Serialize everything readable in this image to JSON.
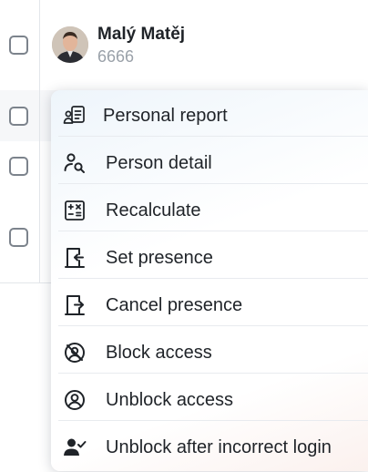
{
  "list": {
    "selected_person": {
      "name": "Malý Matěj",
      "id": "6666"
    }
  },
  "context_menu": {
    "items": [
      {
        "label": "Personal report",
        "icon": "personal-report-icon"
      },
      {
        "label": "Person detail",
        "icon": "person-search-icon"
      },
      {
        "label": "Recalculate",
        "icon": "calculator-icon"
      },
      {
        "label": "Set presence",
        "icon": "door-enter-icon"
      },
      {
        "label": "Cancel presence",
        "icon": "door-exit-icon"
      },
      {
        "label": "Block access",
        "icon": "user-blocked-icon"
      },
      {
        "label": "Unblock access",
        "icon": "user-circle-icon"
      },
      {
        "label": "Unblock after incorrect login",
        "icon": "user-check-icon"
      }
    ]
  },
  "colors": {
    "text": "#1f2328",
    "muted": "#9aa1a9",
    "border": "#e3e6ea",
    "checkbox": "#7c838c"
  }
}
